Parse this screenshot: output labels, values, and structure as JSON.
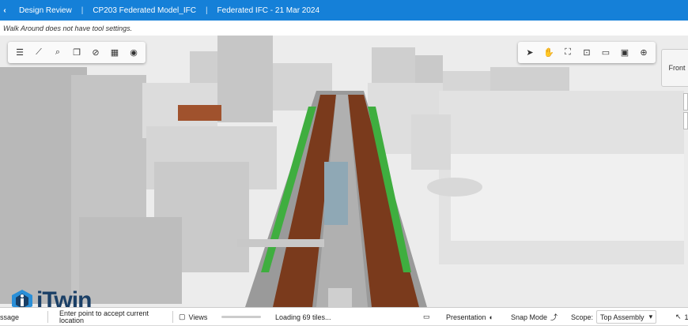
{
  "header": {
    "breadcrumbs": [
      "Design Review",
      "CP203 Federated Model_IFC",
      "Federated IFC - 21 Mar 2024"
    ]
  },
  "info_bar": {
    "message": "Walk Around does not have tool settings."
  },
  "toolbar_left": {
    "tools": [
      "menu-icon",
      "measure-icon",
      "search-icon",
      "copy-icon",
      "hide-icon",
      "isolate-icon",
      "visibility-icon"
    ]
  },
  "toolbar_right": {
    "tools": [
      "select-icon",
      "pan-hand-icon",
      "fit-view-icon",
      "zoom-window-icon",
      "window-area-icon",
      "section-icon",
      "zoom-icon"
    ]
  },
  "view_cube": {
    "label": "Front"
  },
  "logo": {
    "text": "iTwin"
  },
  "footer": {
    "messages_label": "ssage",
    "prompt_text": "Enter point to accept current location",
    "views_label": "Views",
    "loading_text": "Loading 69 tiles...",
    "presentation_label": "Presentation",
    "snap_mode_label": "Snap Mode",
    "scope_label": "Scope:",
    "scope_value": "Top Assembly",
    "extra": "1"
  },
  "colors": {
    "brand": "#1580d8",
    "road": "#7a3a1c",
    "green": "#3fae3f",
    "building": "#d9d9d9"
  }
}
